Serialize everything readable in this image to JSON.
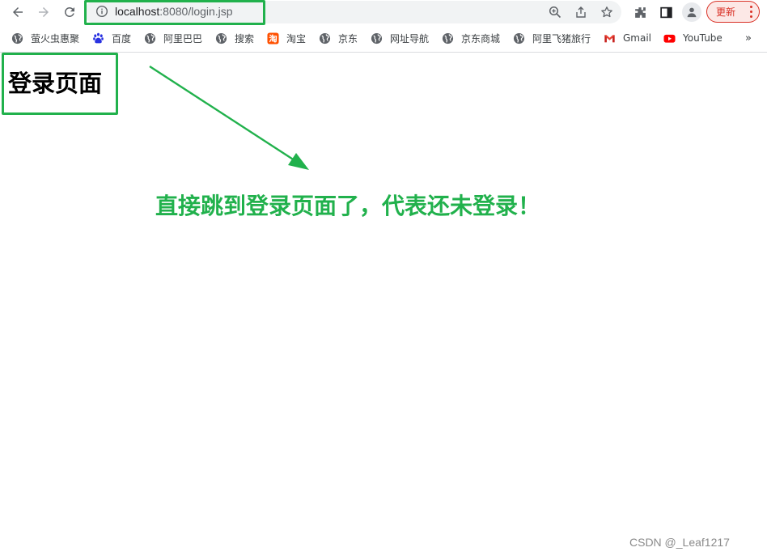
{
  "browser": {
    "url_host": "localhost",
    "url_port": ":8080",
    "url_path": "/login.jsp",
    "update_button_label": "更新"
  },
  "bookmarks": [
    {
      "label": "萤火虫惠聚",
      "icon": "globe-icon"
    },
    {
      "label": "百度",
      "icon": "baidu-icon"
    },
    {
      "label": "阿里巴巴",
      "icon": "globe-icon"
    },
    {
      "label": "搜索",
      "icon": "globe-icon"
    },
    {
      "label": "淘宝",
      "icon": "taobao-icon"
    },
    {
      "label": "京东",
      "icon": "globe-icon"
    },
    {
      "label": "网址导航",
      "icon": "globe-icon"
    },
    {
      "label": "京东商城",
      "icon": "globe-icon"
    },
    {
      "label": "阿里飞猪旅行",
      "icon": "globe-icon"
    },
    {
      "label": "Gmail",
      "icon": "gmail-icon"
    },
    {
      "label": "YouTube",
      "icon": "youtube-icon"
    }
  ],
  "bookmarks_overflow": "»",
  "page": {
    "heading": "登录页面"
  },
  "annotation": {
    "text": "直接跳到登录页面了，代表还未登录！",
    "color": "#21b14c"
  },
  "watermark": "CSDN @_Leaf1217"
}
